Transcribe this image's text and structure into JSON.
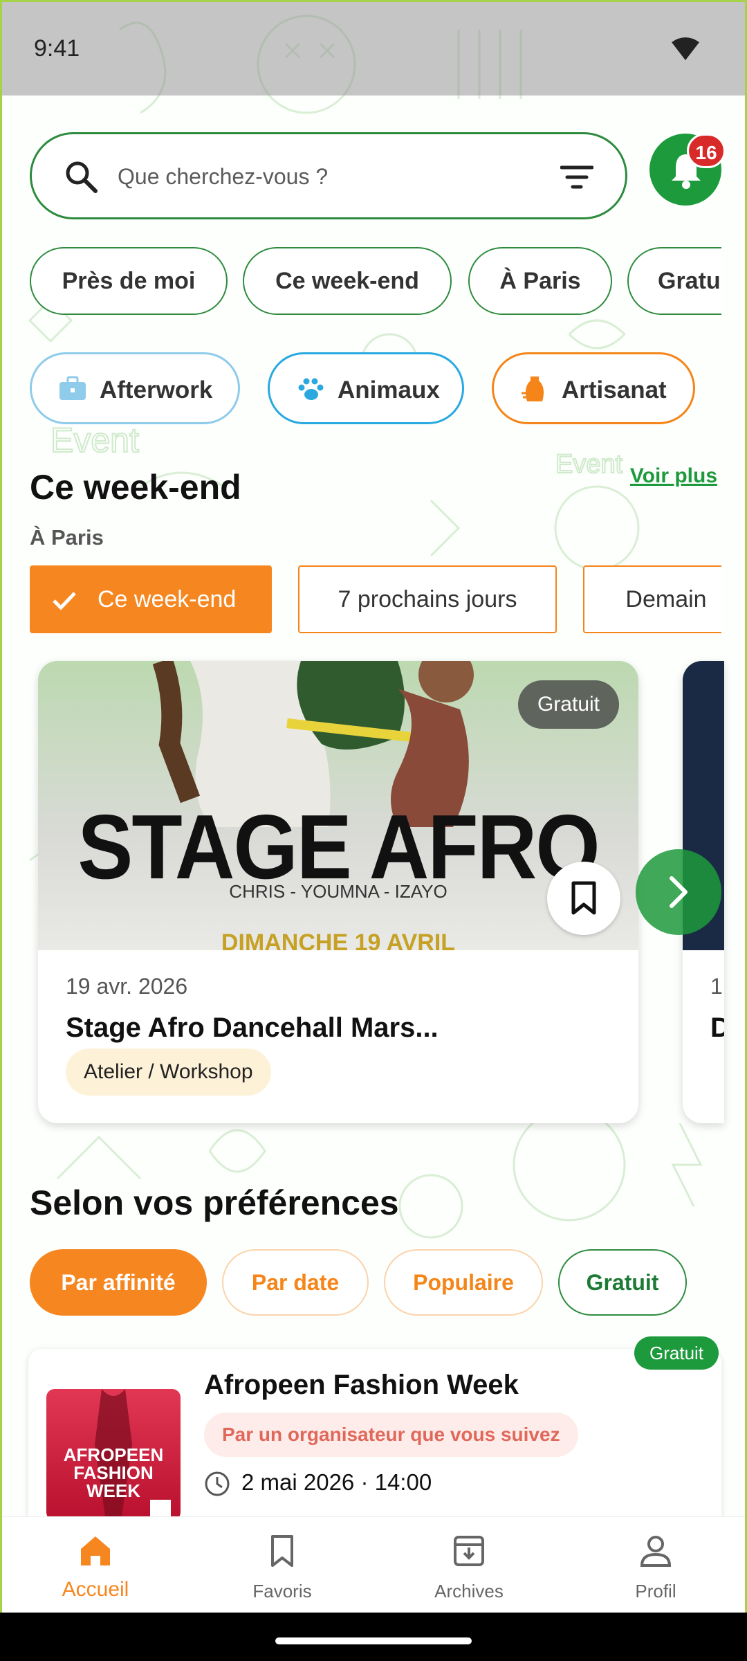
{
  "status_bar": {
    "time": "9:41"
  },
  "search": {
    "placeholder": "Que cherchez-vous ?",
    "notification_count": "16"
  },
  "quick_filters": [
    "Près de moi",
    "Ce week-end",
    "À Paris",
    "Gratuit"
  ],
  "categories": [
    {
      "label": "Afterwork",
      "icon": "briefcase-icon",
      "color": "#8fcbea"
    },
    {
      "label": "Animaux",
      "icon": "paw-icon",
      "color": "#29a9e0"
    },
    {
      "label": "Artisanat",
      "icon": "vase-icon",
      "color": "#f58518"
    }
  ],
  "weekend_section": {
    "title": "Ce week-end",
    "see_more": "Voir plus",
    "location": "À Paris",
    "time_filters": [
      "Ce week-end",
      "7 prochains jours",
      "Demain"
    ]
  },
  "event_card": {
    "poster_title": "STAGE AFRO",
    "poster_subtitle": "CHRIS - YOUMNA - IZAYO",
    "poster_date": "DIMANCHE 19 AVRIL",
    "price": "Gratuit",
    "date": "19 avr. 2026",
    "title": "Stage Afro Dancehall Mars...",
    "tag": "Atelier / Workshop"
  },
  "next_card": {
    "date_partial": "1",
    "title_partial": "D"
  },
  "preferences_section": {
    "title": "Selon vos préférences",
    "sort_options": [
      "Par affinité",
      "Par date",
      "Populaire",
      "Gratuit"
    ]
  },
  "list_event": {
    "badge": "Gratuit",
    "title": "Afropeen Fashion Week",
    "reason": "Par un organisateur que vous suivez",
    "datetime": "2 mai 2026 · 14:00",
    "thumb_title": "AFROPEEN FASHION WEEK"
  },
  "bottom_nav": [
    {
      "label": "Accueil",
      "icon": "home-icon",
      "active": true
    },
    {
      "label": "Favoris",
      "icon": "bookmark-icon",
      "active": false
    },
    {
      "label": "Archives",
      "icon": "archive-icon",
      "active": false
    },
    {
      "label": "Profil",
      "icon": "person-icon",
      "active": false
    }
  ],
  "colors": {
    "green": "#1d9a3c",
    "orange": "#f6861f",
    "badge_red": "#d92a2a"
  }
}
